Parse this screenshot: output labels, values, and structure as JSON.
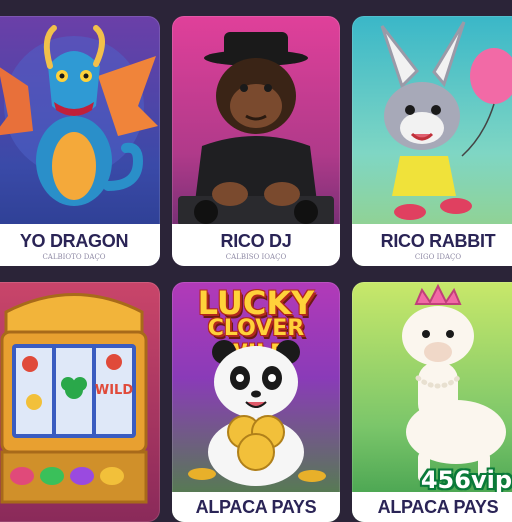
{
  "tiles": [
    {
      "name": "YO DRAGON",
      "subtitle": "CALBIOTO DAÇO"
    },
    {
      "name": "RICO DJ",
      "subtitle": "CALBISO IOAÇO"
    },
    {
      "name": "RICO RABBIT",
      "subtitle": "CIGO IDAÇO"
    },
    {
      "name": "",
      "subtitle": ""
    },
    {
      "name": "ALPACA PAYS",
      "title_line1": "LUCKY",
      "title_line2": "CLOVER WILD"
    },
    {
      "name": "ALPACA PAYS"
    }
  ],
  "slot_reel_text": "WILD",
  "watermark": "456vip",
  "colors": {
    "dragon_bg": "#3a4aa8",
    "dj_bg": "#c0388a",
    "rabbit_bg": "#3ab7c8",
    "slot_bg": "#c9456a",
    "lucky_bg": "#8a3bb8",
    "alpaca_bg": "#7bc66a",
    "accent_gold": "#ffd23a"
  },
  "icons": [
    "dragon-icon",
    "gorilla-dj-icon",
    "rabbit-icon",
    "slot-machine-icon",
    "panda-icon",
    "alpaca-icon"
  ]
}
